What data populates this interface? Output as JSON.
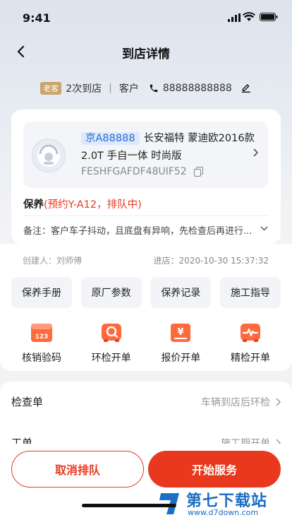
{
  "status_bar": {
    "time": "9:41"
  },
  "header": {
    "title": "到店详情"
  },
  "customer": {
    "tag": "老客",
    "visits": "2次到店",
    "type": "客户",
    "phone": "88888888888"
  },
  "vehicle": {
    "plate": "京A88888",
    "model_line1": "长安福特 蒙迪欧2016款",
    "model_line2": "2.0T 手自一体 时尚版",
    "vin": "FESHFGAFDF48UIF52"
  },
  "service": {
    "name": "保养",
    "status": "(预约Y-A12，排队中)",
    "note": "备注：客户车子抖动，且底盘有异响，先检查后再进行..."
  },
  "info": {
    "creator": "创建人：刘师傅",
    "arrival": "进店：2020-10-30 15:37:32"
  },
  "quick_buttons": [
    "保养手册",
    "原厂参数",
    "保养记录",
    "施工指导"
  ],
  "actions": [
    {
      "label": "核销验码",
      "icon": "voucher-icon"
    },
    {
      "label": "环检开单",
      "icon": "inspection-car-icon"
    },
    {
      "label": "报价开单",
      "icon": "quote-icon"
    },
    {
      "label": "精检开单",
      "icon": "diagnostic-icon"
    }
  ],
  "list": [
    {
      "label": "检查单",
      "value": "车辆到店后环检"
    },
    {
      "label": "工单",
      "value": "施工期开单"
    }
  ],
  "footer": {
    "cancel": "取消排队",
    "start": "开始服务"
  },
  "watermark": {
    "text": "第七下载站",
    "url": "www.d7down.com"
  },
  "colors": {
    "accent": "#e8391e",
    "plate_blue": "#2a6fd6",
    "old_tag": "#c9a46b"
  }
}
